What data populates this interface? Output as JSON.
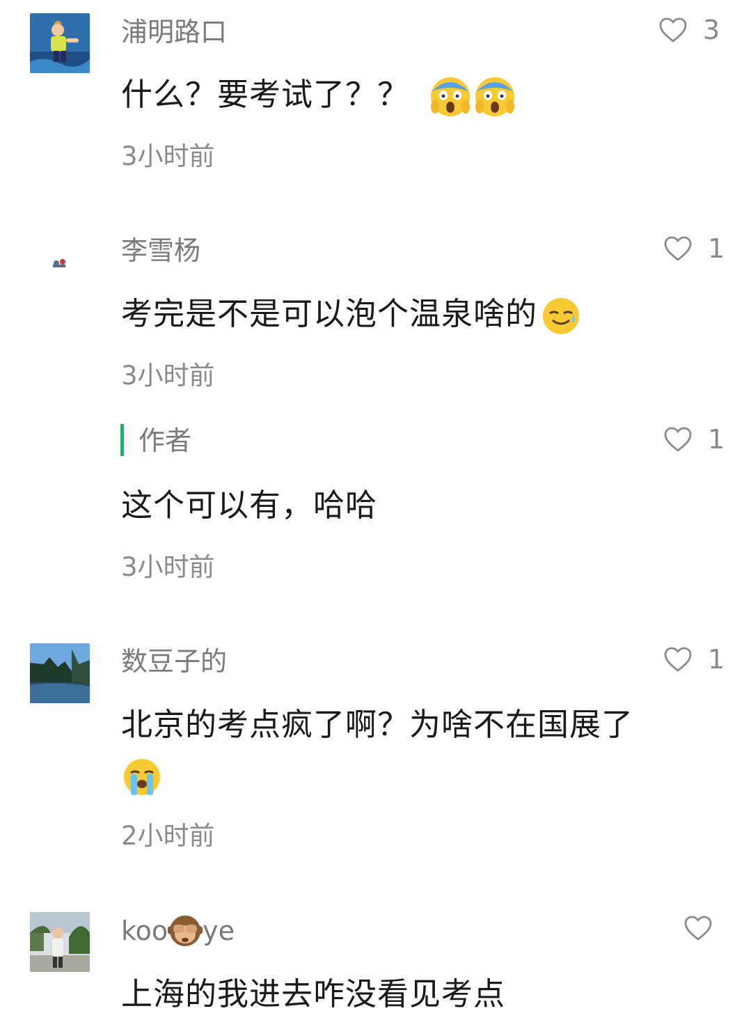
{
  "comments": [
    {
      "name": "浦明路口",
      "text": "什么？要考试了？？",
      "emoji": [
        "scream-emoji",
        "scream-emoji"
      ],
      "time": "3小时前",
      "likes": "3"
    },
    {
      "name": "李雪杨",
      "text": "考完是不是可以泡个温泉啥的",
      "emoji": [
        "sweat-smile-emoji"
      ],
      "time": "3小时前",
      "likes": "1",
      "reply": {
        "label": "作者",
        "text": "这个可以有，哈哈",
        "time": "3小时前",
        "likes": "1"
      }
    },
    {
      "name": "数豆子的",
      "text": "北京的考点疯了啊？为啥不在国展了",
      "emoji": [
        "loudly-crying-emoji"
      ],
      "time": "2小时前",
      "likes": "1"
    },
    {
      "name_part1": "koo",
      "name_emoji": "see-no-evil-monkey-emoji",
      "name_part2": "ye",
      "text": "上海的我进去咋没看见考点"
    }
  ],
  "colors": {
    "author_accent": "#07c160",
    "meta_text": "#8a8a8a",
    "body_text": "#191919"
  },
  "icons": [
    "heart-outline-icon"
  ]
}
